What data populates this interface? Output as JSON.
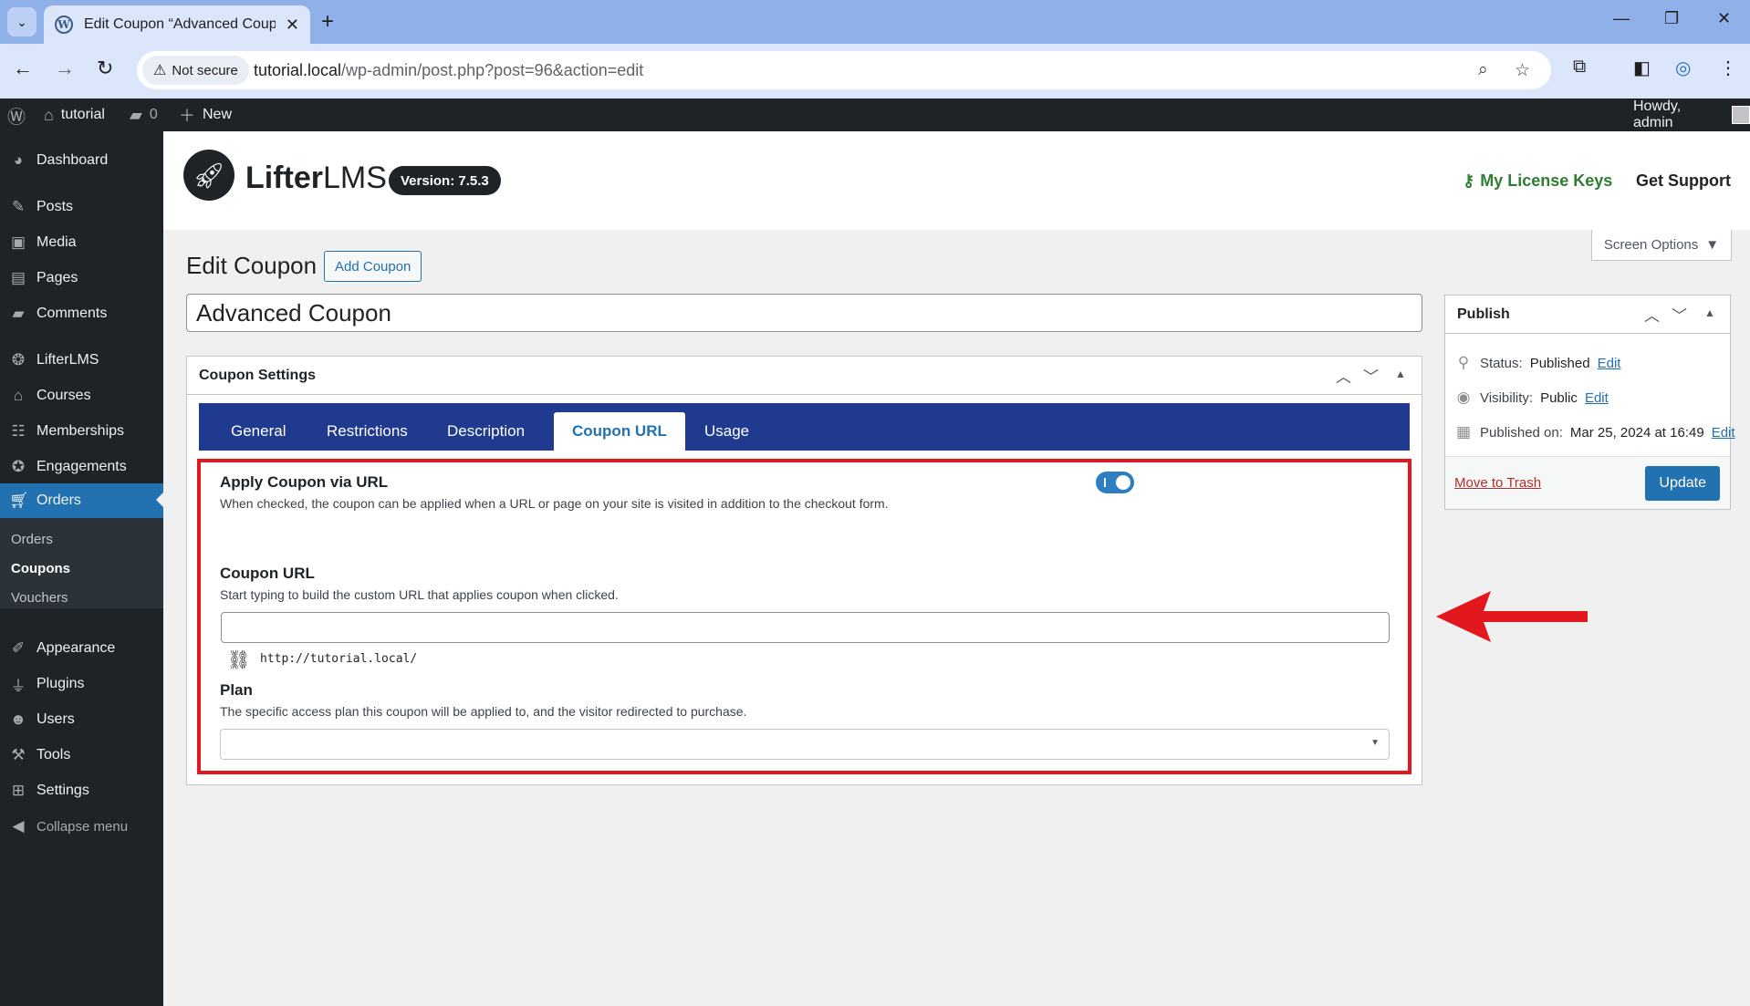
{
  "browser": {
    "tab_title": "Edit Coupon “Advanced Coupon”",
    "new_tab_label": "+",
    "security_label": "Not secure",
    "url_host": "tutorial.local",
    "url_path": "/wp-admin/post.php?post=96&action=edit"
  },
  "adminbar": {
    "site_name": "tutorial",
    "comments_count": "0",
    "new_label": "New",
    "howdy": "Howdy, admin"
  },
  "sidebar": {
    "items": [
      {
        "label": "Dashboard",
        "icon": "dashboard-icon"
      },
      {
        "label": "Posts",
        "icon": "pin-icon"
      },
      {
        "label": "Media",
        "icon": "media-icon"
      },
      {
        "label": "Pages",
        "icon": "pages-icon"
      },
      {
        "label": "Comments",
        "icon": "comment-icon"
      },
      {
        "label": "LifterLMS",
        "icon": "lifterlms-icon"
      },
      {
        "label": "Courses",
        "icon": "graduation-cap-icon"
      },
      {
        "label": "Memberships",
        "icon": "groups-icon"
      },
      {
        "label": "Engagements",
        "icon": "award-icon"
      },
      {
        "label": "Orders",
        "icon": "cart-icon"
      },
      {
        "label": "Appearance",
        "icon": "brush-icon"
      },
      {
        "label": "Plugins",
        "icon": "plug-icon"
      },
      {
        "label": "Users",
        "icon": "user-icon"
      },
      {
        "label": "Tools",
        "icon": "wrench-icon"
      },
      {
        "label": "Settings",
        "icon": "settings-icon"
      }
    ],
    "submenu": [
      "Orders",
      "Coupons",
      "Vouchers"
    ],
    "collapse_label": "Collapse menu"
  },
  "llms_header": {
    "brand_bold": "Lifter",
    "brand_light": "LMS",
    "version": "Version: 7.5.3",
    "license_link": "My License Keys",
    "support_link": "Get Support"
  },
  "screen_options": "Screen Options",
  "page": {
    "title": "Edit Coupon",
    "add_button": "Add Coupon",
    "post_title": "Advanced Coupon"
  },
  "coupon_settings": {
    "box_title": "Coupon Settings",
    "tabs": [
      "General",
      "Restrictions",
      "Description",
      "Coupon URL",
      "Usage"
    ],
    "active_tab": "Coupon URL",
    "apply_label": "Apply Coupon via URL",
    "apply_desc": "When checked, the coupon can be applied when a URL or page on your site is visited in addition to the checkout form.",
    "apply_enabled": true,
    "url_label": "Coupon URL",
    "url_desc": "Start typing to build the custom URL that applies coupon when clicked.",
    "url_value": "",
    "url_preview": "http://tutorial.local/",
    "plan_label": "Plan",
    "plan_desc": "The specific access plan this coupon will be applied to, and the visitor redirected to purchase.",
    "plan_value": ""
  },
  "publish": {
    "title": "Publish",
    "status_label": "Status:",
    "status_value": "Published",
    "visibility_label": "Visibility:",
    "visibility_value": "Public",
    "published_label": "Published on:",
    "published_value": "Mar 25, 2024 at 16:49",
    "edit_link": "Edit",
    "trash_link": "Move to Trash",
    "update_button": "Update"
  },
  "colors": {
    "wp_dark": "#1d2327",
    "wp_blue": "#2271b1",
    "tab_bar": "#1f3a8f",
    "highlight": "#e3181e",
    "license_green": "#2e7d32"
  }
}
